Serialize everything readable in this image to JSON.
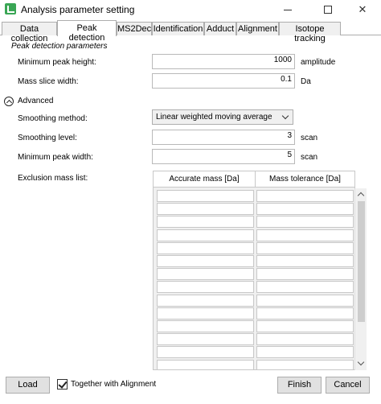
{
  "window": {
    "title": "Analysis parameter setting"
  },
  "tabs": [
    {
      "label": "Data collection"
    },
    {
      "label": "Peak detection"
    },
    {
      "label": "MS2Dec"
    },
    {
      "label": "Identification"
    },
    {
      "label": "Adduct"
    },
    {
      "label": "Alignment"
    },
    {
      "label": "Isotope tracking"
    }
  ],
  "active_tab": "Peak detection",
  "peak_detection": {
    "section_title": "Peak detection parameters",
    "min_peak_height": {
      "label": "Minimum peak height:",
      "value": "1000",
      "unit": "amplitude"
    },
    "mass_slice_width": {
      "label": "Mass slice width:",
      "value": "0.1",
      "unit": "Da"
    },
    "advanced": {
      "label": "Advanced",
      "smoothing_method": {
        "label": "Smoothing method:",
        "value": "Linear weighted moving average"
      },
      "smoothing_level": {
        "label": "Smoothing level:",
        "value": "3",
        "unit": "scan"
      },
      "min_peak_width": {
        "label": "Minimum peak width:",
        "value": "5",
        "unit": "scan"
      },
      "exclusion_list": {
        "label": "Exclusion mass list:",
        "columns": [
          "Accurate mass [Da]",
          "Mass tolerance [Da]"
        ],
        "rows": 14
      }
    }
  },
  "footer": {
    "load_label": "Load",
    "together_label": "Together with Alignment",
    "together_checked": true,
    "finish_label": "Finish",
    "cancel_label": "Cancel"
  }
}
